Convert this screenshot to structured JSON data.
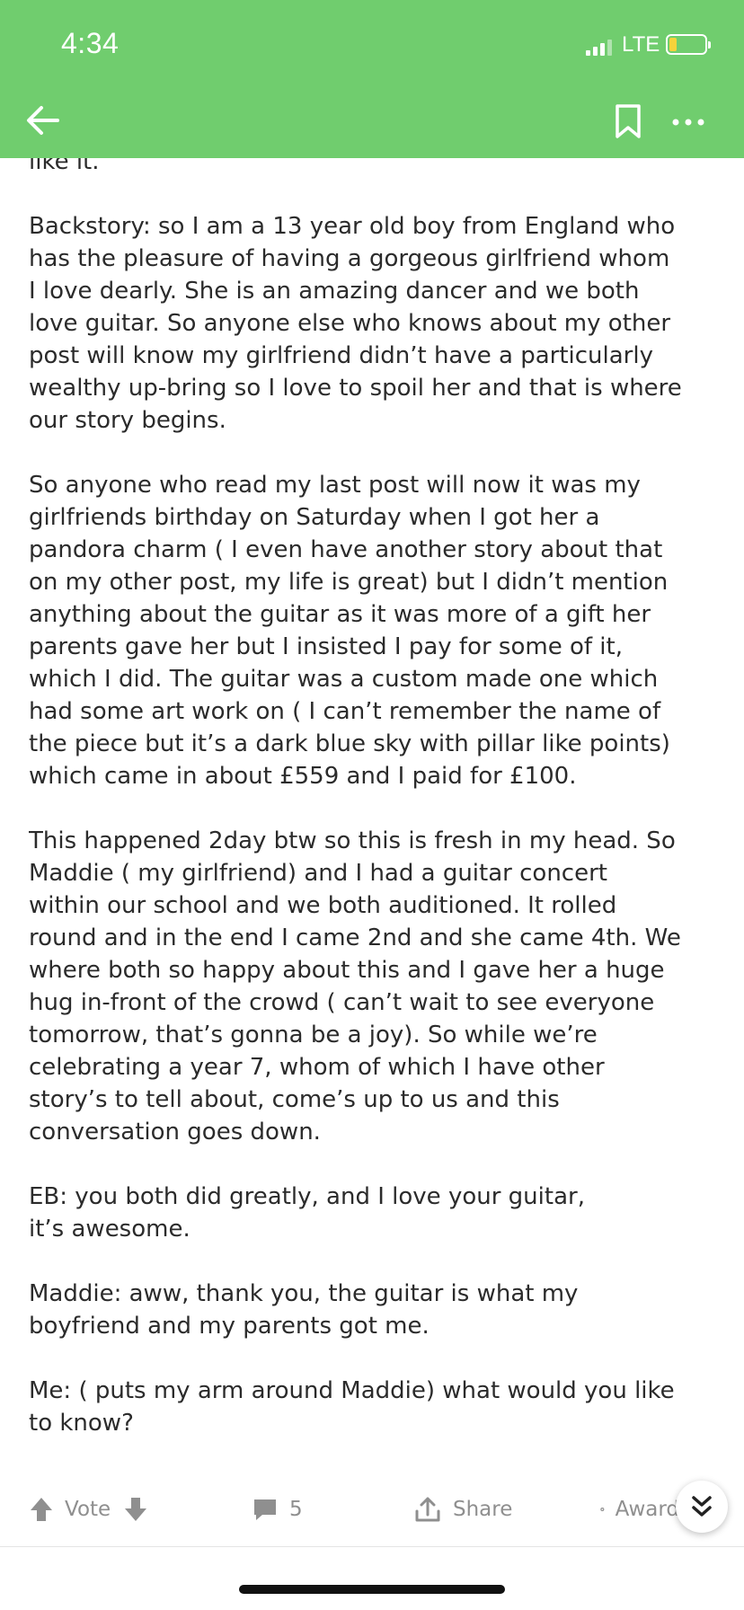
{
  "status_bar": {
    "time": "4:34",
    "network": "LTE",
    "battery_level": 0.15
  },
  "app_bar": {
    "background": "#70cd6e",
    "back_icon": "arrow-left-icon",
    "bookmark_icon": "bookmark-icon",
    "more_icon": "more-horizontal-icon"
  },
  "post": {
    "paragraphs": [
      "like it.",
      "Backstory: so I am a 13 year old boy from England who\nhas the pleasure of having a gorgeous girlfriend whom\nI love dearly. She is an amazing dancer and we both\nlove guitar. So anyone else who knows about my other\npost will know my girlfriend didn’t have a particularly\nwealthy up-bring so I love to spoil her and that is where\nour story begins.",
      "So anyone who read my last post will now it was my\ngirlfriends birthday on Saturday when I got her a\npandora charm ( I even have another story about that\non my other post, my life is great) but I didn’t mention\nanything about the guitar as it was more of a gift her\nparents gave her but I insisted I pay for some of it,\nwhich I did. The guitar was a custom made one which\nhad some art work on ( I can’t remember the name of\nthe piece but it’s a dark blue sky with pillar like points)\nwhich came in about £559 and I paid for £100.",
      "This happened 2day btw so this is fresh in my head. So\nMaddie ( my girlfriend) and I had a guitar concert\nwithin our school and we both auditioned. It rolled\nround and in the end I came 2nd and she came 4th. We\nwhere both so happy about this and I gave her a huge\nhug in-front of the crowd ( can’t wait to see everyone\ntomorrow, that’s gonna be a joy). So while we’re\ncelebrating a year 7, whom of which I have other\nstory’s to tell about, come’s up to us and this\nconversation goes down.",
      "EB: you both did greatly, and I love your guitar,\nit’s awesome.",
      "Maddie: aww, thank you, the guitar is what my\nboyfriend and my parents got me.",
      "Me: ( puts my arm around Maddie) what would you like\nto know?"
    ]
  },
  "actions": {
    "vote_label": "Vote",
    "comment_count": "5",
    "share_label": "Share",
    "awards_label": "Awards"
  },
  "colors": {
    "accent": "#70cd6e",
    "action_gray": "#8f8f8f",
    "battery_low": "#f5d33b"
  }
}
